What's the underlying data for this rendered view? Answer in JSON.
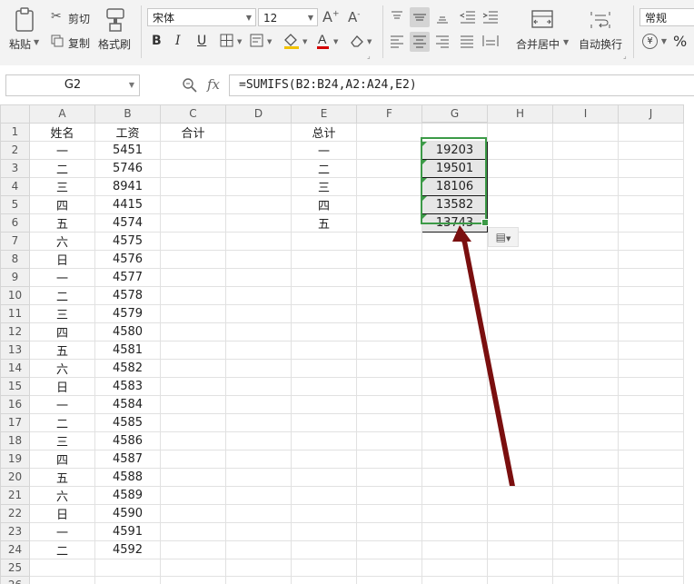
{
  "ribbon": {
    "paste": "粘贴",
    "cut": "剪切",
    "copy": "复制",
    "format_painter": "格式刷",
    "font_name": "宋体",
    "font_size": "12",
    "bold": "B",
    "italic": "I",
    "underline": "U",
    "font_color_letter": "A",
    "merge_center": "合并居中",
    "wrap_text": "自动换行",
    "number_format": "常规",
    "currency_symbol": "¥",
    "percent_symbol": "%"
  },
  "formula_bar": {
    "name_box": "G2",
    "fx": "fx",
    "formula": "=SUMIFS(B2:B24,A2:A24,E2)"
  },
  "columns": [
    "A",
    "B",
    "C",
    "D",
    "E",
    "F",
    "G",
    "H",
    "I",
    "J"
  ],
  "rows": [
    "1",
    "2",
    "3",
    "4",
    "5",
    "6",
    "7",
    "8",
    "9",
    "10",
    "11",
    "12",
    "13",
    "14",
    "15",
    "16",
    "17",
    "18",
    "19",
    "20",
    "21",
    "22",
    "23",
    "24",
    "25",
    "26"
  ],
  "headers": {
    "A1": "姓名",
    "B1": "工资",
    "C1": "合计",
    "E1": "总计"
  },
  "col_a": [
    "一",
    "二",
    "三",
    "四",
    "五",
    "六",
    "日",
    "一",
    "二",
    "三",
    "四",
    "五",
    "六",
    "日",
    "一",
    "二",
    "三",
    "四",
    "五",
    "六",
    "日",
    "一",
    "二"
  ],
  "col_b": [
    "5451",
    "5746",
    "8941",
    "4415",
    "4574",
    "4575",
    "4576",
    "4577",
    "4578",
    "4579",
    "4580",
    "4581",
    "4582",
    "4583",
    "4584",
    "4585",
    "4586",
    "4587",
    "4588",
    "4589",
    "4590",
    "4591",
    "4592"
  ],
  "col_e": [
    "一",
    "二",
    "三",
    "四",
    "五"
  ],
  "col_g": [
    "19203",
    "19501",
    "18106",
    "13582",
    "13743"
  ],
  "colors": {
    "selection": "#3c9a47",
    "arrow": "#7a0f0f"
  }
}
